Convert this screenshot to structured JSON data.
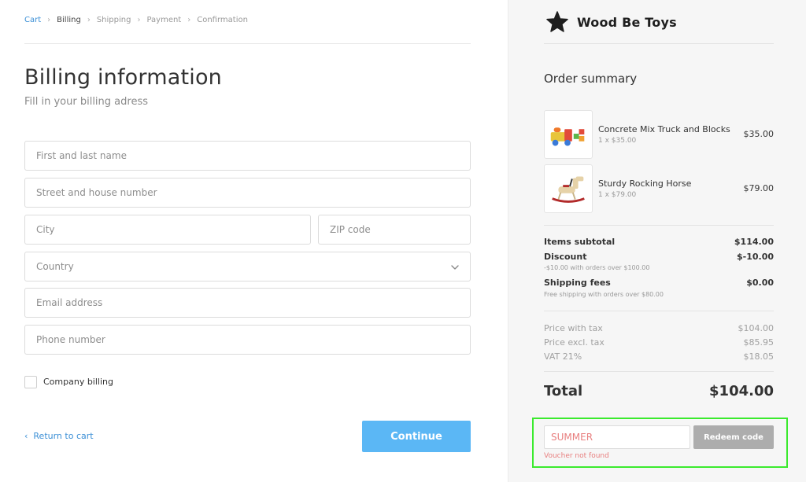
{
  "breadcrumb": {
    "items": [
      {
        "label": "Cart",
        "state": "link"
      },
      {
        "label": "Billing",
        "state": "current"
      },
      {
        "label": "Shipping",
        "state": "upcoming"
      },
      {
        "label": "Payment",
        "state": "upcoming"
      },
      {
        "label": "Confirmation",
        "state": "upcoming"
      }
    ],
    "separator": "›"
  },
  "billing": {
    "title": "Billing information",
    "subtitle": "Fill in your billing adress",
    "fields": {
      "name": {
        "placeholder": "First and last name",
        "value": ""
      },
      "street": {
        "placeholder": "Street and house number",
        "value": ""
      },
      "city": {
        "placeholder": "City",
        "value": ""
      },
      "zip": {
        "placeholder": "ZIP code",
        "value": ""
      },
      "country": {
        "placeholder": "Country",
        "value": ""
      },
      "email": {
        "placeholder": "Email address",
        "value": ""
      },
      "phone": {
        "placeholder": "Phone number",
        "value": ""
      }
    },
    "company_billing_label": "Company billing",
    "company_billing_checked": false,
    "return_label": "Return to cart",
    "continue_label": "Continue"
  },
  "brand": {
    "name": "Wood Be Toys",
    "icon": "star-icon"
  },
  "summary": {
    "title": "Order summary",
    "items": [
      {
        "name": "Concrete Mix Truck and Blocks",
        "qty": "1 x $35.00",
        "price": "$35.00",
        "image": "toy-truck-image"
      },
      {
        "name": "Sturdy Rocking Horse",
        "qty": "1 x $79.00",
        "price": "$79.00",
        "image": "rocking-horse-image"
      }
    ],
    "subtotal": {
      "label": "Items subtotal",
      "value": "$114.00"
    },
    "discount": {
      "label": "Discount",
      "value": "$-10.00",
      "note": "-$10.00 with orders over $100.00"
    },
    "shipping": {
      "label": "Shipping fees",
      "value": "$0.00",
      "note": "Free shipping with orders over $80.00"
    },
    "price_with_tax": {
      "label": "Price with tax",
      "value": "$104.00"
    },
    "price_excl_tax": {
      "label": "Price excl. tax",
      "value": "$85.95"
    },
    "vat": {
      "label": "VAT 21%",
      "value": "$18.05"
    },
    "total": {
      "label": "Total",
      "value": "$104.00"
    }
  },
  "voucher": {
    "value": "SUMMER",
    "button_label": "Redeem code",
    "error": "Voucher not found"
  },
  "colors": {
    "link": "#3b8fd6",
    "continue": "#5bb7f5",
    "error": "#e87f7f",
    "highlight": "#3bea2e",
    "redeem": "#adadad"
  }
}
